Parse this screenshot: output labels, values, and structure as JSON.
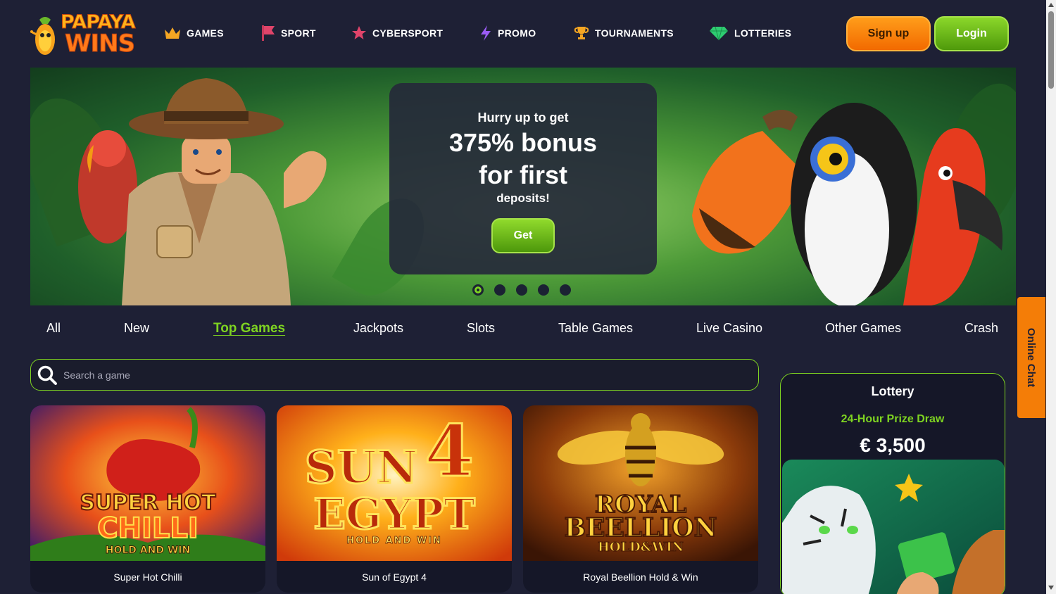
{
  "brand": {
    "line1": "PAPAYA",
    "line2": "WINS"
  },
  "nav": [
    {
      "label": "GAMES",
      "icon": "crown-icon"
    },
    {
      "label": "SPORT",
      "icon": "flag-icon"
    },
    {
      "label": "CYBERSPORT",
      "icon": "star-icon"
    },
    {
      "label": "PROMO",
      "icon": "lightning-icon"
    },
    {
      "label": "TOURNAMENTS",
      "icon": "trophy-icon"
    },
    {
      "label": "LOTTERIES",
      "icon": "diamond-icon"
    }
  ],
  "auth": {
    "signup": "Sign up",
    "login": "Login"
  },
  "promo": {
    "line1": "Hurry up to get",
    "line2": "375% bonus",
    "line3": "for first",
    "line4": "deposits!",
    "cta": "Get",
    "slides": 5,
    "active_slide": 1
  },
  "categories": [
    "All",
    "New",
    "Top Games",
    "Jackpots",
    "Slots",
    "Table Games",
    "Live Casino",
    "Other Games",
    "Crash"
  ],
  "active_category": "Top Games",
  "search": {
    "placeholder": "Search a game"
  },
  "games": [
    {
      "name": "Super Hot Chilli",
      "art_line1": "SUPER HOT",
      "art_line2": "CHILLI",
      "art_line3": "HOLD AND WIN"
    },
    {
      "name": "Sun of Egypt 4",
      "art_line1": "SUN",
      "art_line2": "EGYPT",
      "art_line3": "HOLD AND WIN"
    },
    {
      "name": "Royal Beellion Hold & Win",
      "art_line1": "ROYAL",
      "art_line2": "BEELLION",
      "art_line3": "HOLD&WIN"
    }
  ],
  "lottery": {
    "title": "Lottery",
    "subtitle": "24-Hour Prize Draw",
    "amount": "€ 3,500"
  },
  "chat": {
    "label": "Online Chat"
  },
  "colors": {
    "accent": "#7ed321",
    "orange": "#f47d07",
    "bg": "#1e2035"
  }
}
